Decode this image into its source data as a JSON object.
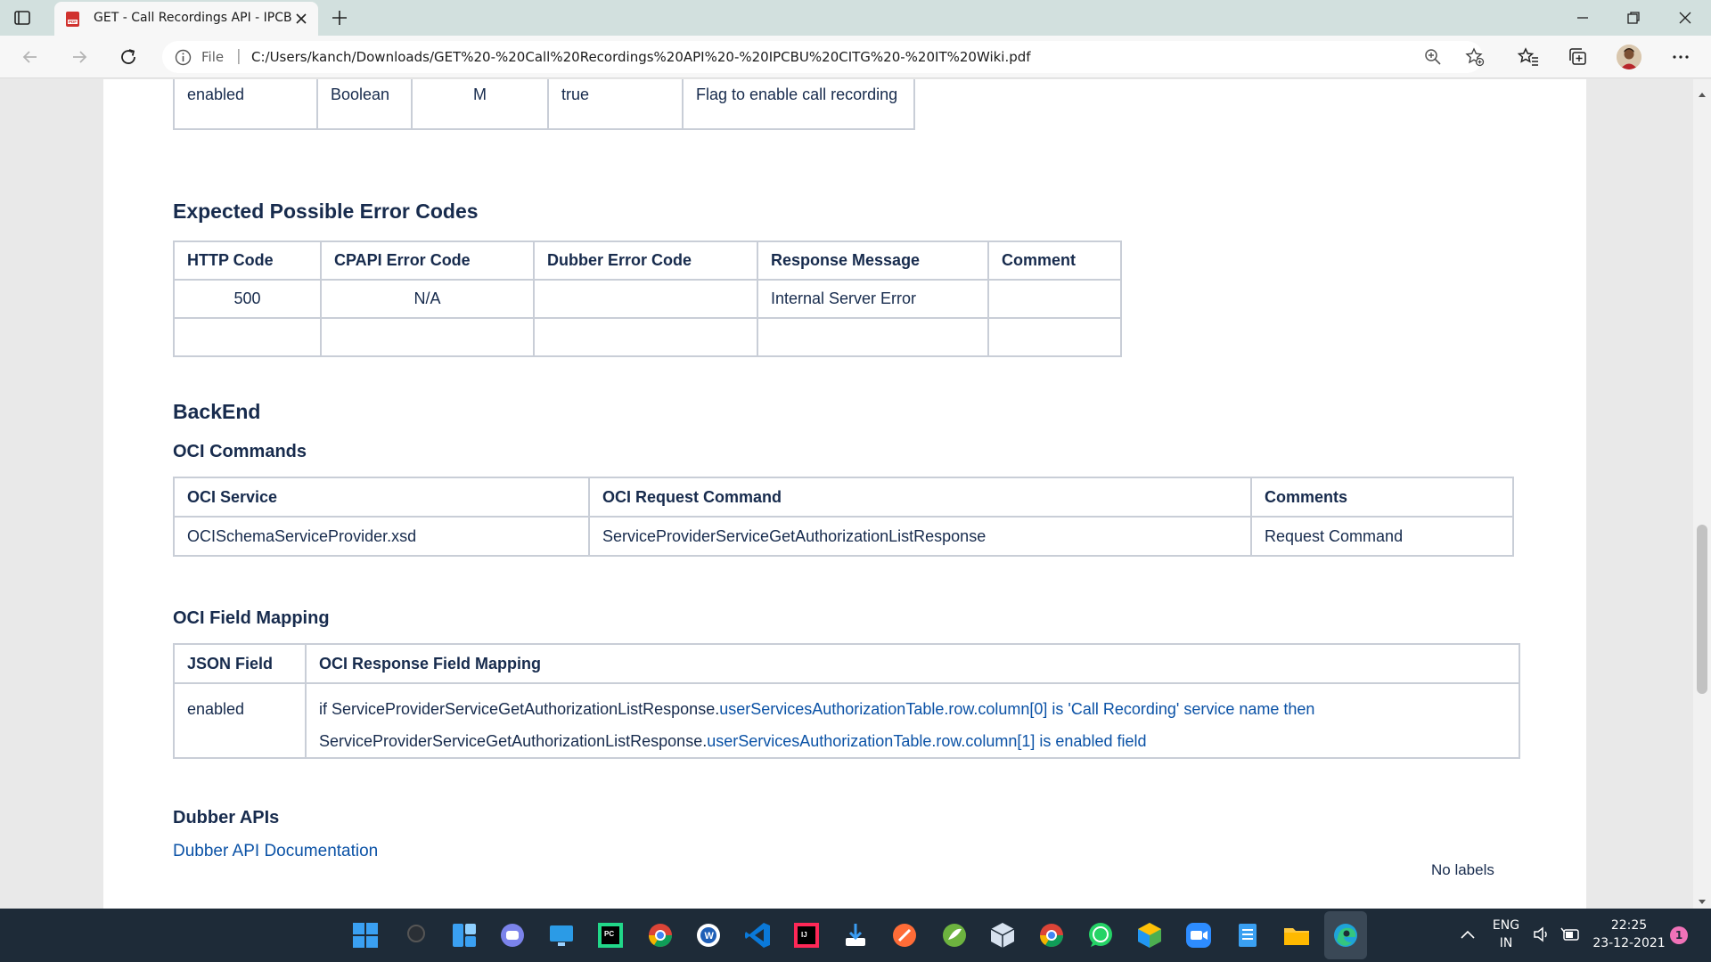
{
  "browser": {
    "tab_title": "GET - Call Recordings API - IPCBU",
    "url_scheme": "File",
    "url": "C:/Users/kanch/Downloads/GET%20-%20Call%20Recordings%20API%20-%20IPCBU%20CITG%20-%20IT%20Wiki.pdf"
  },
  "document": {
    "params_tail_row": {
      "name": "enabled",
      "type": "Boolean",
      "mandatory": "M",
      "example": "true",
      "description": "Flag to enable call recording"
    },
    "errors": {
      "heading": "Expected Possible Error Codes",
      "headers": [
        "HTTP Code",
        "CPAPI Error Code",
        "Dubber Error Code",
        "Response Message",
        "Comment"
      ],
      "rows": [
        [
          "500",
          "N/A",
          "",
          "Internal Server Error",
          ""
        ],
        [
          "",
          "",
          "",
          "",
          ""
        ]
      ]
    },
    "backend_heading": "BackEnd",
    "oci_commands": {
      "heading": "OCI Commands",
      "headers": [
        "OCI Service",
        "OCI Request Command",
        "Comments"
      ],
      "rows": [
        [
          "OCISchemaServiceProvider.xsd",
          "ServiceProviderServiceGetAuthorizationListResponse",
          "Request Command"
        ]
      ]
    },
    "field_mapping": {
      "heading": "OCI Field Mapping",
      "headers": [
        "JSON Field",
        "OCI Response Field Mapping"
      ],
      "row_field": "enabled",
      "line1_plain": "if ServiceProviderServiceGetAuthorizationListResponse.",
      "line1_link": "userServicesAuthorizationTable.row.column[0] is 'Call Recording' service name then",
      "line2_plain": "ServiceProviderServiceGetAuthorizationListResponse.",
      "line2_link": "userServicesAuthorizationTable.row.column[1] is enabled field"
    },
    "dubber": {
      "heading": "Dubber APIs",
      "link": "Dubber API Documentation"
    },
    "labels_note": "No labels"
  },
  "taskbar": {
    "apps": [
      "windows-start",
      "search",
      "widgets",
      "teams-chat",
      "remote-desktop",
      "pycharm",
      "chrome-multi",
      "word-app",
      "vscode",
      "intellij",
      "sourcetree",
      "postman",
      "spring-tool",
      "virtualbox",
      "chrome",
      "whatsapp",
      "package",
      "zoom",
      "notepad",
      "file-explorer",
      "edge"
    ],
    "language": "ENG",
    "region": "IN",
    "time": "22:25",
    "date": "23-12-2021",
    "notification_count": "1"
  },
  "colors": {
    "heading_text": "#172b4d",
    "link": "#0b52a6",
    "table_border": "#c9ced7",
    "taskbar": "#1e2b38",
    "tabstrip": "#d2e0de"
  }
}
